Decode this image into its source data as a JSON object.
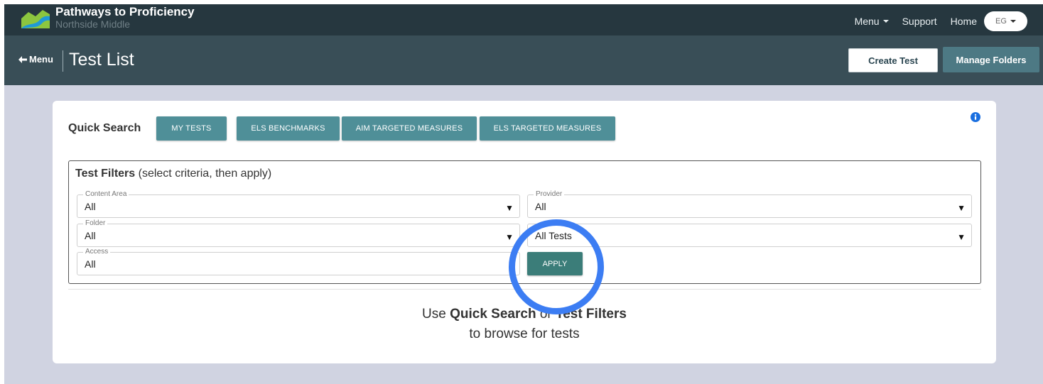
{
  "header": {
    "app_title": "Pathways to Proficiency",
    "school": "Northside Middle",
    "nav": {
      "menu": "Menu",
      "support": "Support",
      "home": "Home"
    },
    "user_initials": "EG"
  },
  "subheader": {
    "back_label": "Menu",
    "page_title": "Test List",
    "create_test": "Create Test",
    "manage_folders": "Manage Folders"
  },
  "quick_search": {
    "label": "Quick Search",
    "buttons": [
      "MY TESTS",
      "ELS BENCHMARKS",
      "AIM TARGETED MEASURES",
      "ELS TARGETED MEASURES"
    ]
  },
  "filters": {
    "title": "Test Filters",
    "subtitle": " (select criteria, then apply)",
    "content_area": {
      "label": "Content Area",
      "value": "All"
    },
    "provider": {
      "label": "Provider",
      "value": "All"
    },
    "folder": {
      "label": "Folder",
      "value": "All"
    },
    "type": {
      "value": "All Tests"
    },
    "access": {
      "label": "Access",
      "value": "All"
    },
    "apply": "APPLY",
    "arrow_glyph": "▼"
  },
  "hint": {
    "prefix": "Use ",
    "quick": "Quick Search",
    "or": " or ",
    "filters": "Test Filters",
    "line2": "to browse for tests"
  },
  "colors": {
    "topbar": "#26373f",
    "subbar": "#394e57",
    "content_bg": "#d0d3e1",
    "teal_button": "#4f8f98",
    "apply_button": "#3b7d79",
    "highlight_ring": "#3c7df3",
    "info_icon": "#1a6fe0"
  }
}
